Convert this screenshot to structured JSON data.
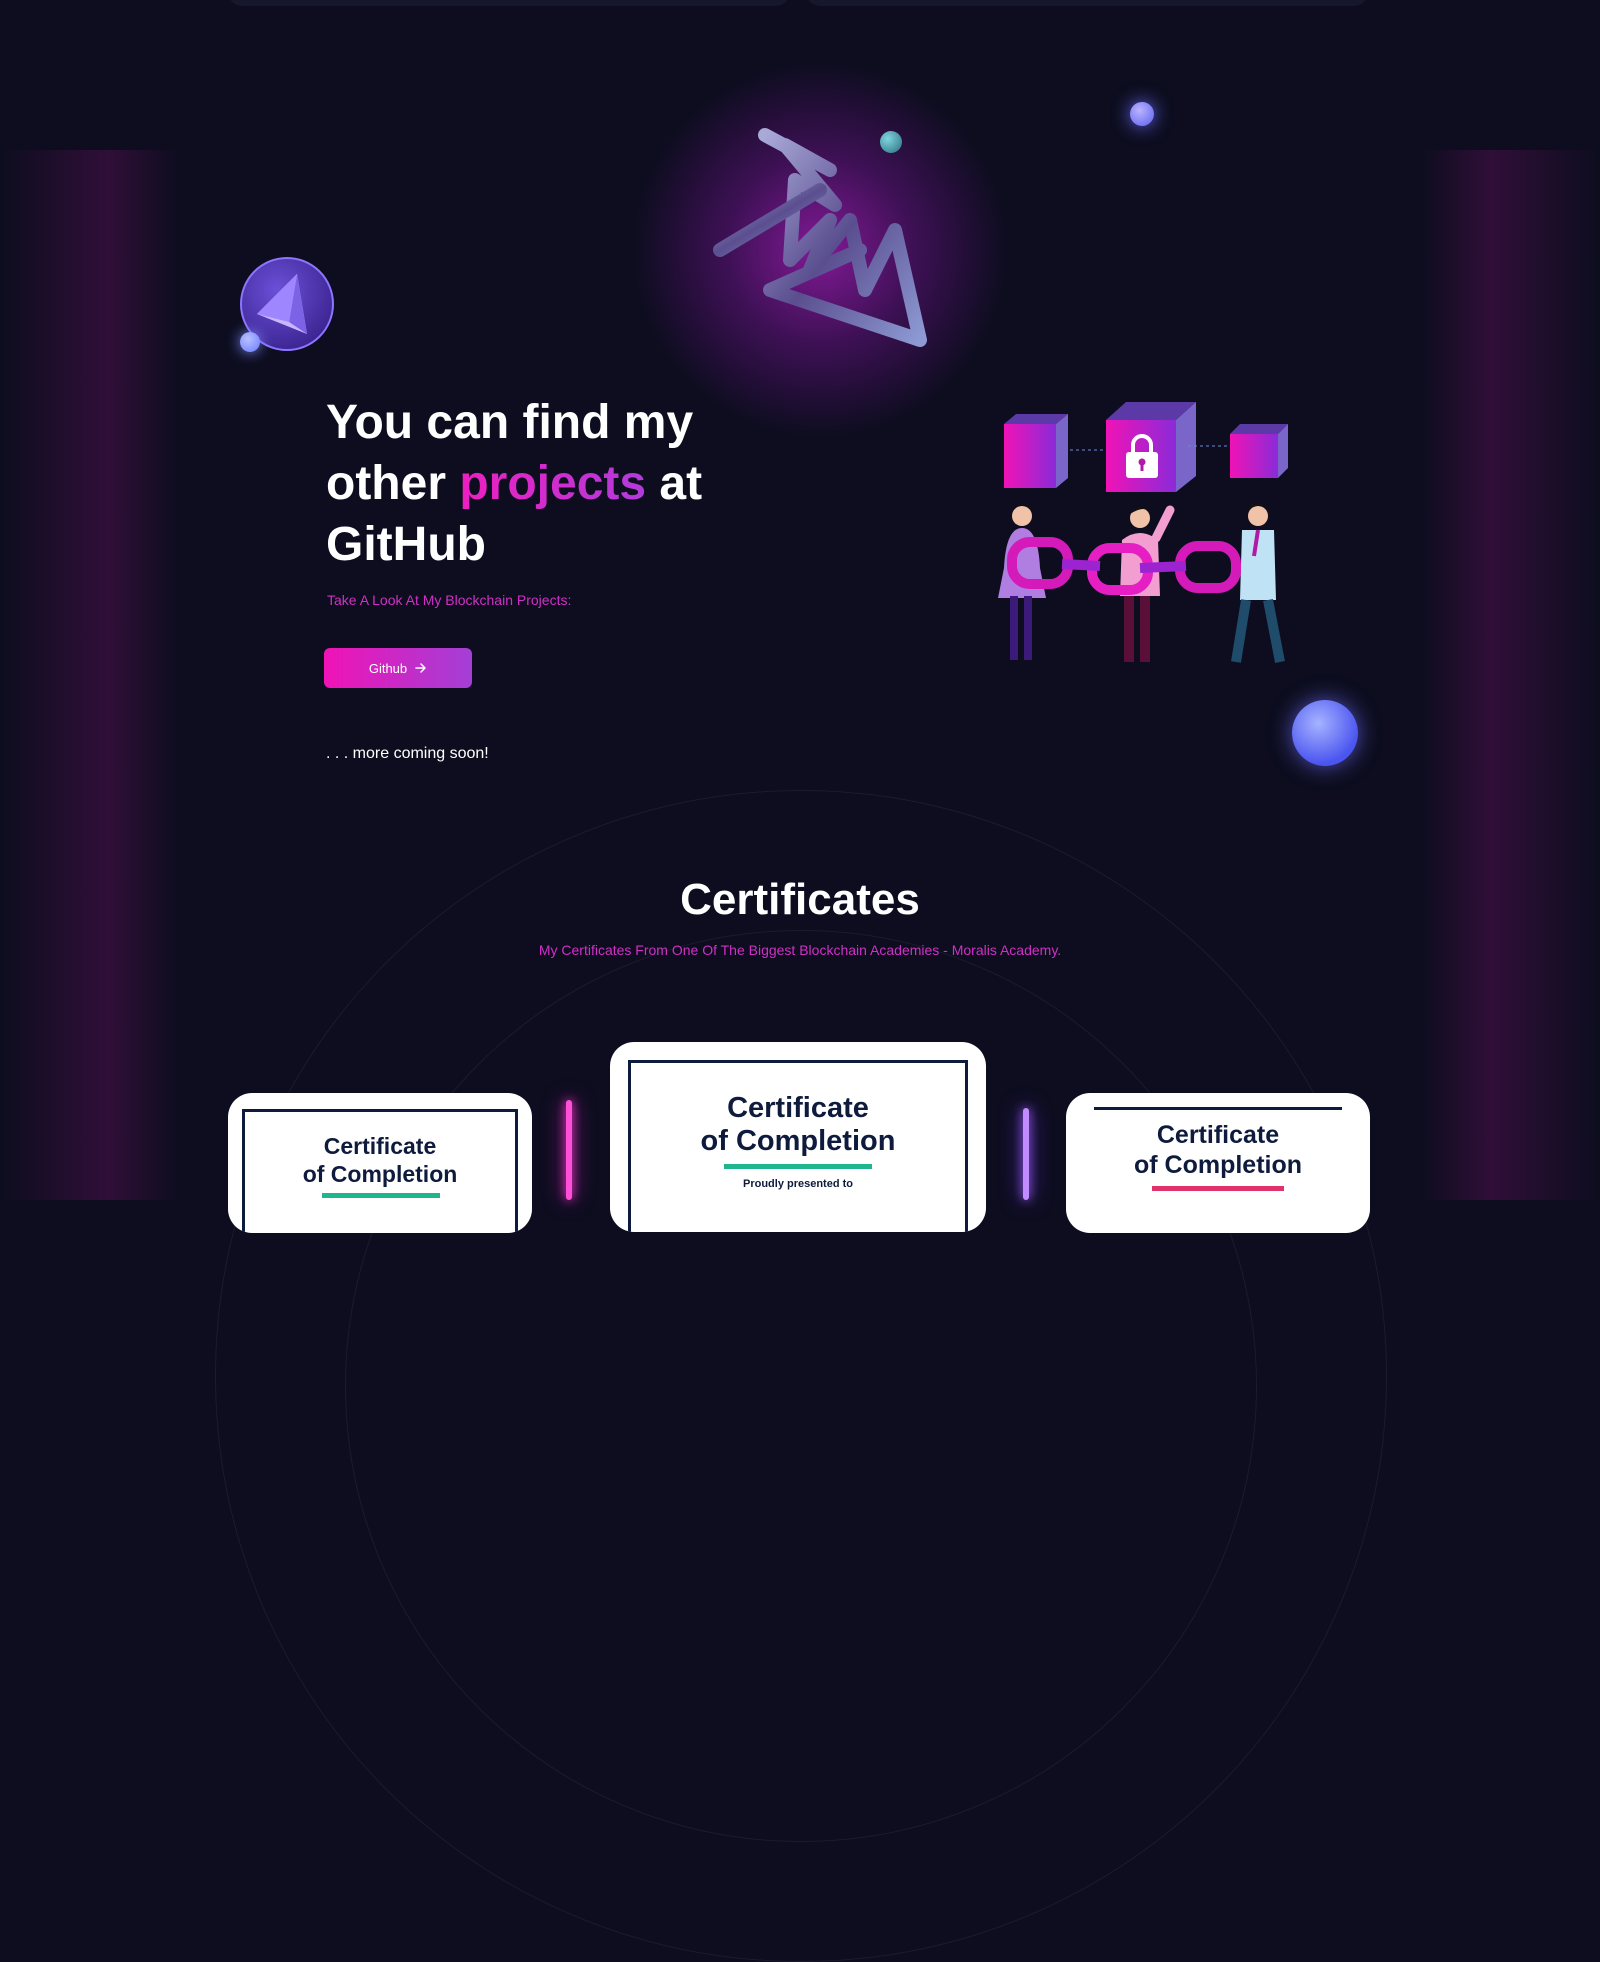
{
  "hero": {
    "headline_part1": "You can find my other ",
    "headline_accent": "projects",
    "headline_part2": " at GitHub",
    "subheading": "Take A Look At My Blockchain Projects:",
    "github_button_label": "Github",
    "coming_soon": ". . . more coming soon!"
  },
  "certificates": {
    "title": "Certificates",
    "subtitle": "My Certificates From One Of The Biggest Blockchain Academies - Moralis Academy.",
    "cards": [
      {
        "line1": "Certificate",
        "line2": "of Completion",
        "accent_color": "#1fb58f"
      },
      {
        "line1": "Certificate",
        "line2": "of Completion",
        "presented": "Proudly presented to",
        "name_partial": "",
        "accent_color": "#1fb58f"
      },
      {
        "line1": "Certificate",
        "line2": "of Completion",
        "accent_color": "#e0336b"
      }
    ]
  },
  "colors": {
    "background": "#0d0d1f",
    "accent_pink": "#ee1fc0",
    "accent_purple": "#a33fd6",
    "cert_navy": "#0e1b3d"
  },
  "icons": [
    "arrow-right-icon",
    "ethereum-icon",
    "padlock-icon"
  ]
}
